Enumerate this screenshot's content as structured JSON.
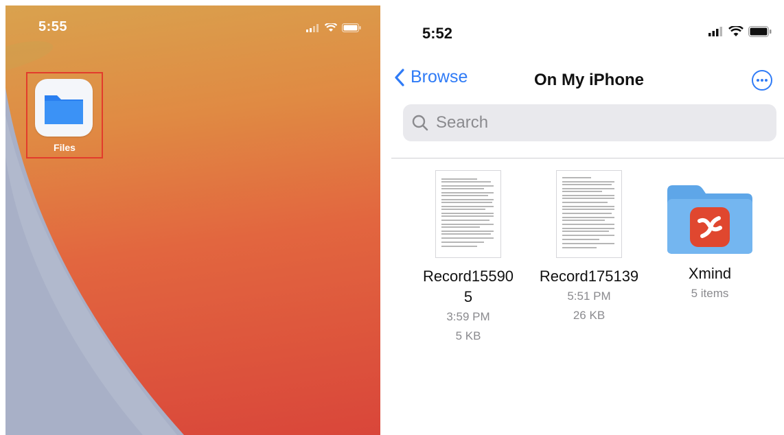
{
  "home": {
    "time": "5:55",
    "app_label": "Files",
    "icons": [
      "signal-icon",
      "wifi-icon",
      "battery-icon"
    ]
  },
  "files": {
    "time": "5:52",
    "back_label": "Browse",
    "title": "On My iPhone",
    "search_placeholder": "Search",
    "items": [
      {
        "name_line1": "Record15590",
        "name_line2": "5",
        "time": "3:59 PM",
        "size": "5 KB",
        "kind": "document"
      },
      {
        "name_line1": "Record175139",
        "time": "5:51 PM",
        "size": "26 KB",
        "kind": "document"
      },
      {
        "name_line1": "Xmind",
        "detail": "5 items",
        "kind": "folder"
      }
    ]
  },
  "colors": {
    "accent": "#2f7bf6",
    "highlight_box": "#e23b2c",
    "folder": "#6ab0ec",
    "xmind": "#e0472f"
  }
}
